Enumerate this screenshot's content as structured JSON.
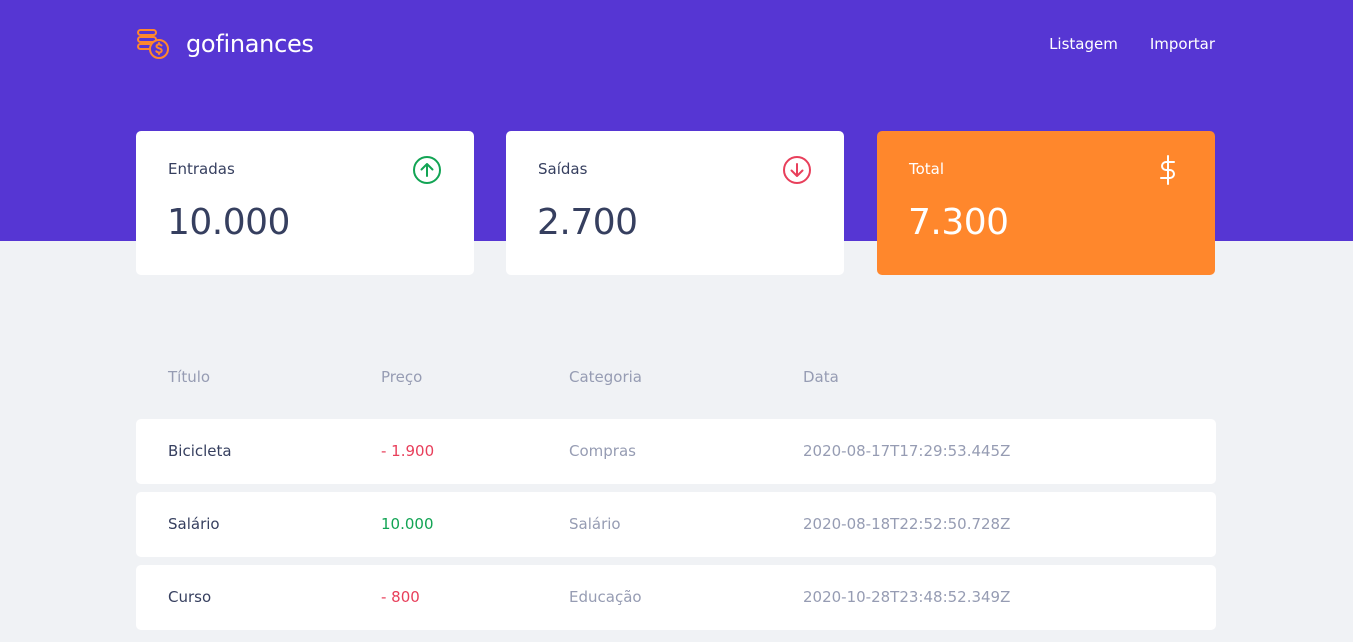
{
  "brand": {
    "name": "gofinances",
    "logo_icon": "coins-dollar-icon",
    "logo_color": "#ff872c"
  },
  "nav": {
    "items": [
      {
        "label": "Listagem"
      },
      {
        "label": "Importar"
      }
    ]
  },
  "colors": {
    "header_bg": "#5636d3",
    "page_bg": "#f0f2f5",
    "income": "#12a454",
    "outcome": "#e83f5b",
    "total_bg": "#ff872c"
  },
  "cards": {
    "income": {
      "label": "Entradas",
      "value": "10.000",
      "icon": "arrow-up-circle-icon"
    },
    "outcome": {
      "label": "Saídas",
      "value": "2.700",
      "icon": "arrow-down-circle-icon"
    },
    "total": {
      "label": "Total",
      "value": "7.300",
      "icon": "dollar-sign-icon"
    }
  },
  "table": {
    "headers": [
      "Título",
      "Preço",
      "Categoria",
      "Data"
    ],
    "rows": [
      {
        "title": "Bicicleta",
        "price": "- 1.900",
        "type": "outcome",
        "category": "Compras",
        "date": "2020-08-17T17:29:53.445Z"
      },
      {
        "title": "Salário",
        "price": "10.000",
        "type": "income",
        "category": "Salário",
        "date": "2020-08-18T22:52:50.728Z"
      },
      {
        "title": "Curso",
        "price": "- 800",
        "type": "outcome",
        "category": "Educação",
        "date": "2020-10-28T23:48:52.349Z"
      }
    ]
  }
}
